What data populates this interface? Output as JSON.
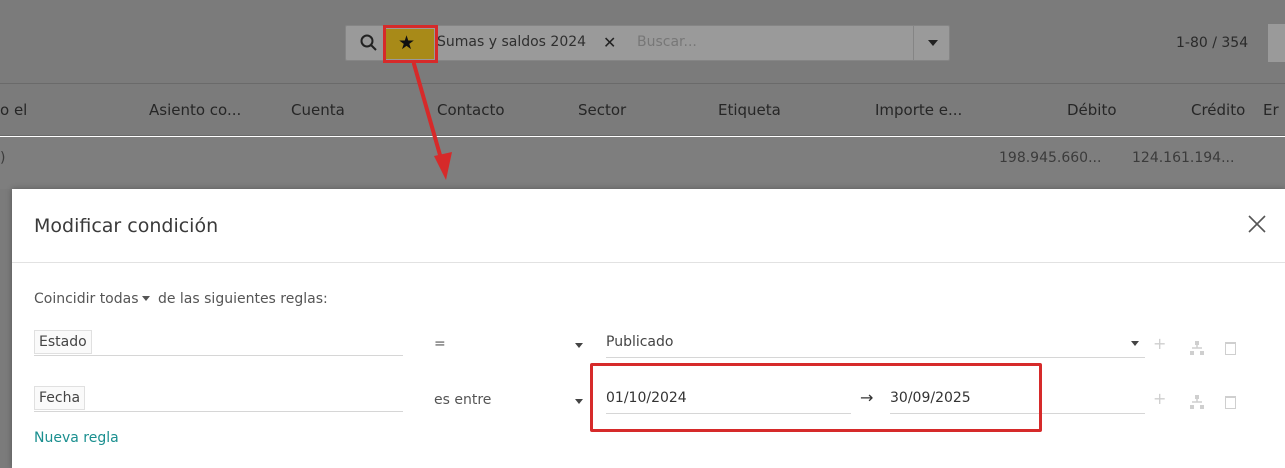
{
  "search": {
    "facet_label": "Sumas y saldos 2024",
    "facet_remove": "✕",
    "placeholder": "Buscar..."
  },
  "pager": {
    "range": "1-80 / 354"
  },
  "table": {
    "columns": [
      "o el",
      "Asiento co...",
      "Cuenta",
      "Contacto",
      "Sector",
      "Etiqueta",
      "Importe e...",
      "Débito",
      "Crédito",
      "Er"
    ],
    "row_label": ")",
    "debit_total": "198.945.660...",
    "credit_total": "124.161.194..."
  },
  "modal": {
    "title": "Modificar condición",
    "match_prefix": "Coincidir",
    "match_mode": "todas",
    "match_suffix": "de las siguientes reglas:",
    "rules": [
      {
        "field": "Estado",
        "operator": "=",
        "value": "Publicado"
      },
      {
        "field": "Fecha",
        "operator": "es entre",
        "from": "01/10/2024",
        "to": "30/09/2025"
      }
    ],
    "range_arrow": "→",
    "add_symbol": "+",
    "new_rule": "Nueva regla"
  },
  "colors": {
    "highlight": "#d62a2a",
    "link": "#1a8f8f",
    "facet_bg": "#a88a18"
  }
}
